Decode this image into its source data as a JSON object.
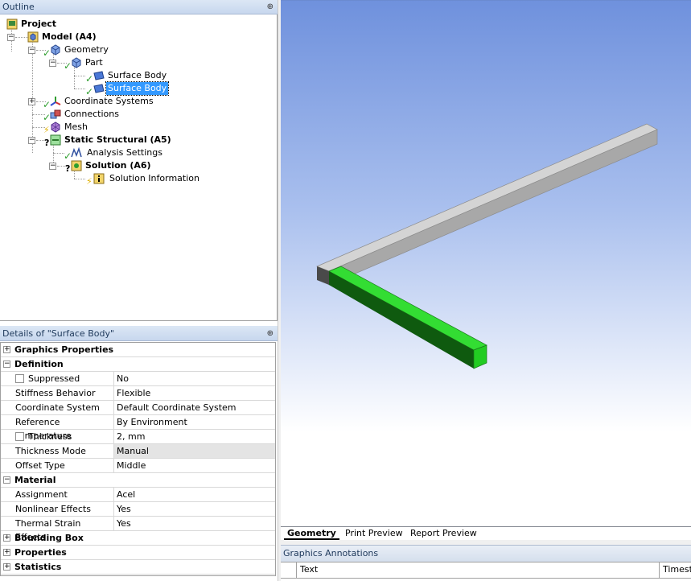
{
  "outline": {
    "title": "Outline",
    "pin": "⊕",
    "tree": {
      "project": "Project",
      "model": "Model (A4)",
      "geometry": "Geometry",
      "part": "Part",
      "surface_body_1": "Surface Body",
      "surface_body_2": "Surface Body",
      "coordinate_systems": "Coordinate Systems",
      "connections": "Connections",
      "mesh": "Mesh",
      "static_structural": "Static Structural (A5)",
      "analysis_settings": "Analysis Settings",
      "solution": "Solution (A6)",
      "solution_information": "Solution Information"
    }
  },
  "details": {
    "title": "Details of \"Surface Body\"",
    "pin": "⊕",
    "sections": {
      "graphics_properties": "Graphics Properties",
      "definition": "Definition",
      "material": "Material",
      "bounding_box": "Bounding Box",
      "properties": "Properties",
      "statistics": "Statistics"
    },
    "rows": {
      "suppressed": {
        "key": "Suppressed",
        "value": "No"
      },
      "stiffness_behavior": {
        "key": "Stiffness Behavior",
        "value": "Flexible"
      },
      "coordinate_system": {
        "key": "Coordinate System",
        "value": "Default Coordinate System"
      },
      "reference_temperature": {
        "key": "Reference Temperature",
        "value": "By Environment"
      },
      "thickness": {
        "key": "Thickness",
        "value": "2, mm"
      },
      "thickness_mode": {
        "key": "Thickness Mode",
        "value": "Manual"
      },
      "offset_type": {
        "key": "Offset Type",
        "value": "Middle"
      },
      "assignment": {
        "key": "Assignment",
        "value": "Acel"
      },
      "nonlinear_effects": {
        "key": "Nonlinear Effects",
        "value": "Yes"
      },
      "thermal_strain_effects": {
        "key": "Thermal Strain Effects",
        "value": "Yes"
      }
    }
  },
  "view_tabs": {
    "geometry": "Geometry",
    "print_preview": "Print Preview",
    "report_preview": "Report Preview"
  },
  "annotations": {
    "title": "Graphics Annotations",
    "col_text": "Text",
    "col_timestamp": "Timest"
  },
  "colors": {
    "selected_body": "#22cc22",
    "other_body": "#b8b8b8",
    "selection": "#3399ff"
  }
}
